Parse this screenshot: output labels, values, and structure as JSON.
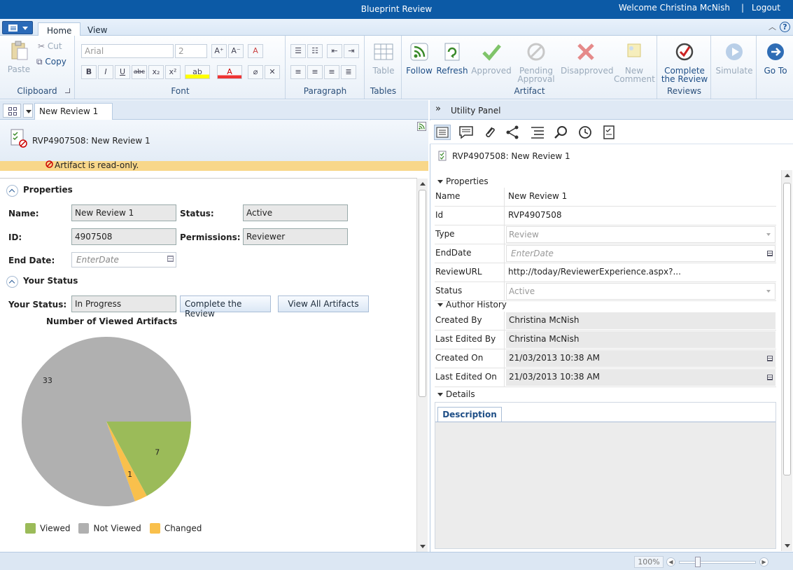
{
  "app": {
    "title": "Blueprint Review",
    "welcome": "Welcome Christina McNish",
    "separator": "|",
    "logout": "Logout",
    "help": "?"
  },
  "ribbon": {
    "tabs": [
      {
        "label": "Home",
        "active": true
      },
      {
        "label": "View",
        "active": false
      }
    ],
    "clipboard": {
      "label": "Clipboard",
      "paste": "Paste",
      "cut": "Cut",
      "copy": "Copy"
    },
    "font": {
      "label": "Font",
      "family": "Arial",
      "size": "2",
      "bold": "B",
      "italic": "I",
      "underline": "U",
      "strike": "abc",
      "subscript": "x₂",
      "superscript": "x²"
    },
    "paragraph": {
      "label": "Paragraph"
    },
    "tables": {
      "label": "Tables",
      "table": "Table"
    },
    "artifact": {
      "label": "Artifact",
      "follow": "Follow",
      "refresh": "Refresh",
      "approved": "Approved",
      "pending_1": "Pending",
      "pending_2": "Approval",
      "disapproved": "Disapproved",
      "new_comment_1": "New",
      "new_comment_2": "Comment"
    },
    "reviews": {
      "label": "Reviews",
      "complete_1": "Complete",
      "complete_2": "the Review"
    },
    "simulate": "Simulate",
    "goto": "Go To"
  },
  "left": {
    "doc_tab": "New Review 1",
    "heading": "RVP4907508: New Review 1",
    "readonly": "Artifact is read-only.",
    "properties_header": "Properties",
    "name_label": "Name:",
    "name_value": "New Review 1",
    "status_label": "Status:",
    "status_value": "Active",
    "id_label": "ID:",
    "id_value": "4907508",
    "permissions_label": "Permissions:",
    "permissions_value": "Reviewer",
    "enddate_label": "End Date:",
    "enddate_placeholder": "EnterDate",
    "your_status_header": "Your Status",
    "your_status_label": "Your Status:",
    "your_status_value": "In Progress",
    "complete_button": "Complete the Review",
    "view_all_button": "View All Artifacts"
  },
  "chart_data": {
    "type": "pie",
    "title": "Number of Viewed Artifacts",
    "slices": [
      {
        "label": "Viewed",
        "value": 7,
        "color": "#9bbb59"
      },
      {
        "label": "Changed",
        "value": 1,
        "color": "#f9c04c"
      },
      {
        "label": "Not Viewed",
        "value": 33,
        "color": "#b0b0b0"
      }
    ],
    "legend": [
      "Viewed",
      "Not Viewed",
      "Changed"
    ],
    "legend_position": "bottom"
  },
  "utility": {
    "title": "Utility Panel",
    "heading": "RVP4907508: New Review 1",
    "properties_header": "Properties",
    "properties": [
      {
        "name": "Name",
        "value": "New Review 1",
        "style": "plain"
      },
      {
        "name": "Id",
        "value": "RVP4907508",
        "style": "plain"
      },
      {
        "name": "Type",
        "value": "Review",
        "style": "dis"
      },
      {
        "name": "EndDate",
        "value": "EnterDate",
        "style": "date"
      },
      {
        "name": "ReviewURL",
        "value": "http://today/ReviewerExperience.aspx?...",
        "style": "plain"
      },
      {
        "name": "Status",
        "value": "Active",
        "style": "dis"
      }
    ],
    "author_header": "Author History",
    "author": [
      {
        "name": "Created By",
        "value": "Christina McNish"
      },
      {
        "name": "Last Edited By",
        "value": "Christina McNish"
      },
      {
        "name": "Created On",
        "value": "21/03/2013 10:38 AM"
      },
      {
        "name": "Last Edited On",
        "value": "21/03/2013 10:38 AM"
      }
    ],
    "details_header": "Details",
    "description_tab": "Description"
  },
  "status": {
    "zoom": "100%"
  },
  "colors": {
    "titlebar": "#0c5aa6",
    "accent": "#1e4e86",
    "viewed": "#9bbb59",
    "not_viewed": "#b0b0b0",
    "changed": "#f9c04c"
  }
}
